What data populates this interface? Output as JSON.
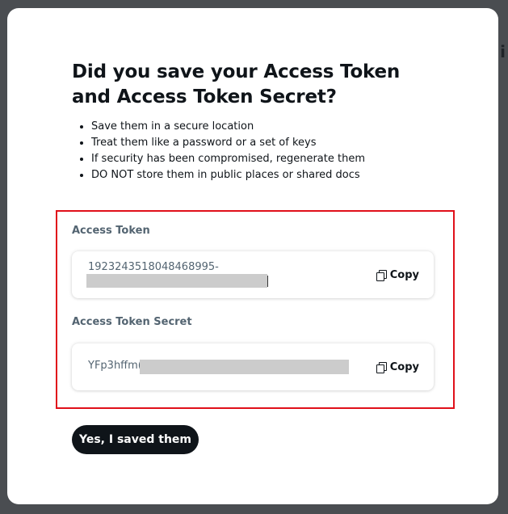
{
  "background": {
    "peek_text": "i"
  },
  "modal": {
    "title": "Did you save your Access Token and Access Token Secret?",
    "bullets": [
      "Save them in a secure location",
      "Treat them like a password or a set of keys",
      "If security has been compromised, regenerate them",
      "DO NOT store them in public places or shared docs"
    ],
    "access_token": {
      "label": "Access Token",
      "value_visible": "1923243518048468995-",
      "copy_label": "Copy"
    },
    "access_token_secret": {
      "label": "Access Token Secret",
      "value_visible": "YFp3hffm(",
      "copy_label": "Copy"
    },
    "confirm_label": "Yes, I saved them"
  },
  "colors": {
    "highlight_border": "#e0101a",
    "primary_button": "#0f1419",
    "label_gray": "#536471"
  },
  "icons": {
    "copy": "copy-icon"
  }
}
